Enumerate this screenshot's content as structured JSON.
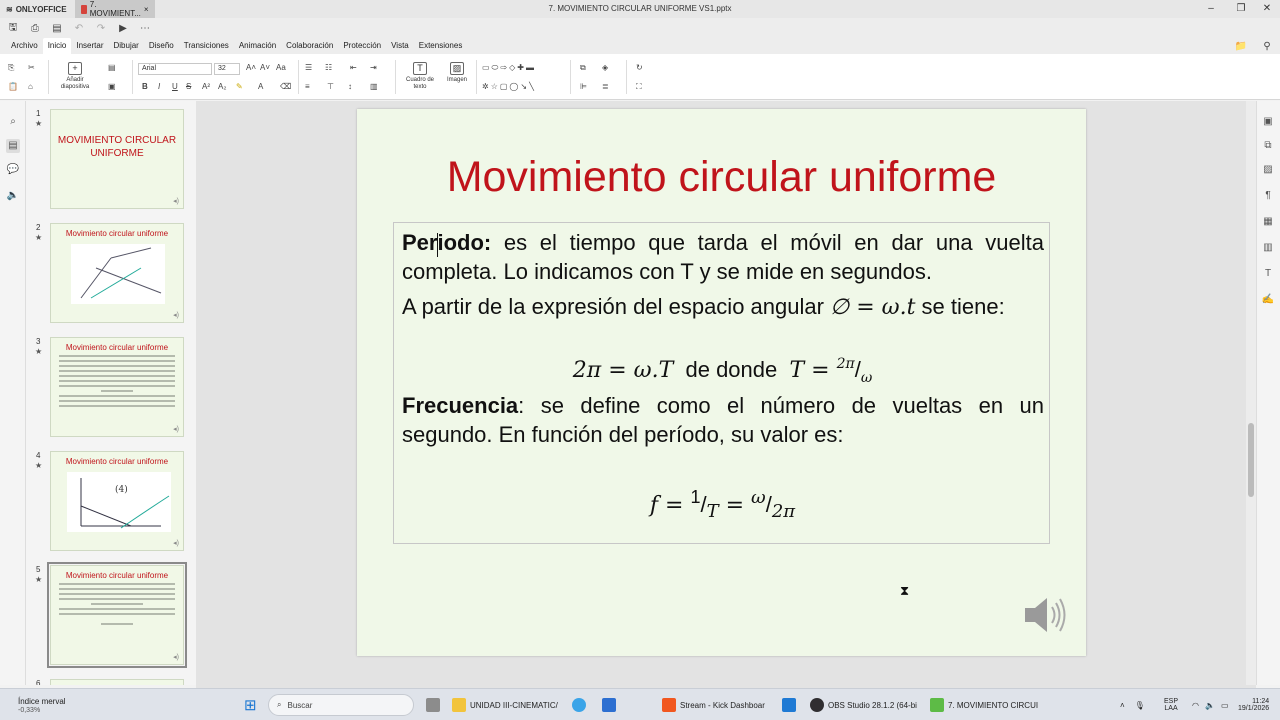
{
  "titlebar": {
    "brand": "ONLYOFFICE",
    "tab_label": "7. MOVIMIENT...",
    "document_title": "7. MOVIMIENTO CIRCULAR UNIFORME VS1.pptx"
  },
  "menu": {
    "tabs": [
      "Archivo",
      "Inicio",
      "Insertar",
      "Dibujar",
      "Diseño",
      "Transiciones",
      "Animación",
      "Colaboración",
      "Protección",
      "Vista",
      "Extensiones"
    ],
    "active": "Inicio"
  },
  "ribbon": {
    "add_slide": "Añadir diapositiva",
    "font_name": "Arial",
    "font_size": "32",
    "text_box": "Cuadro de texto",
    "image": "Imagen"
  },
  "thumbnails": [
    {
      "num": "1",
      "title": "MOVIMIENTO CIRCULAR UNIFORME"
    },
    {
      "num": "2",
      "title": "Movimiento circular uniforme"
    },
    {
      "num": "3",
      "title": "Movimiento circular uniforme"
    },
    {
      "num": "4",
      "title": "Movimiento circular uniforme"
    },
    {
      "num": "5",
      "title": "Movimiento circular uniforme"
    },
    {
      "num": "6"
    }
  ],
  "slide": {
    "title": "Movimiento circular uniforme",
    "periodo_term": "Periodo:",
    "periodo_text": " es el tiempo que tarda el móvil en dar una vuelta completa. Lo indicamos con T y se mide en segundos.",
    "partir_text": "A partir de la expresión del espacio angular ",
    "partir_formula": "∅ = ω.t",
    "partir_tail": " se tiene:",
    "eq_left": "2π = ω.T",
    "eq_mid": "de donde",
    "eq_right_lhs": "T = ",
    "eq_right_num": "2π",
    "eq_right_den": "ω",
    "frecuencia_term": "Frecuencia",
    "frecuencia_text": ": se define como el número de vueltas en un segundo. En función del período, su valor es:",
    "f_lhs": "f = ",
    "f_num1": "1",
    "f_den1": "T",
    "f_eq": " = ",
    "f_num2": "ω",
    "f_den2": "2π"
  },
  "taskbar": {
    "ticker_name": "Índice merval",
    "ticker_value": "-0,33%",
    "search": "Buscar",
    "apps": [
      "UNIDAD III-CINEMATIC/",
      "Stream - Kick Dashboar",
      "OBS Studio 28.1.2 (64-bi",
      "7. MOVIMIENTO CIRCUI"
    ],
    "lang1": "ESP",
    "lang2": "LAA",
    "time": "11:24",
    "date": "19/1/2026"
  }
}
